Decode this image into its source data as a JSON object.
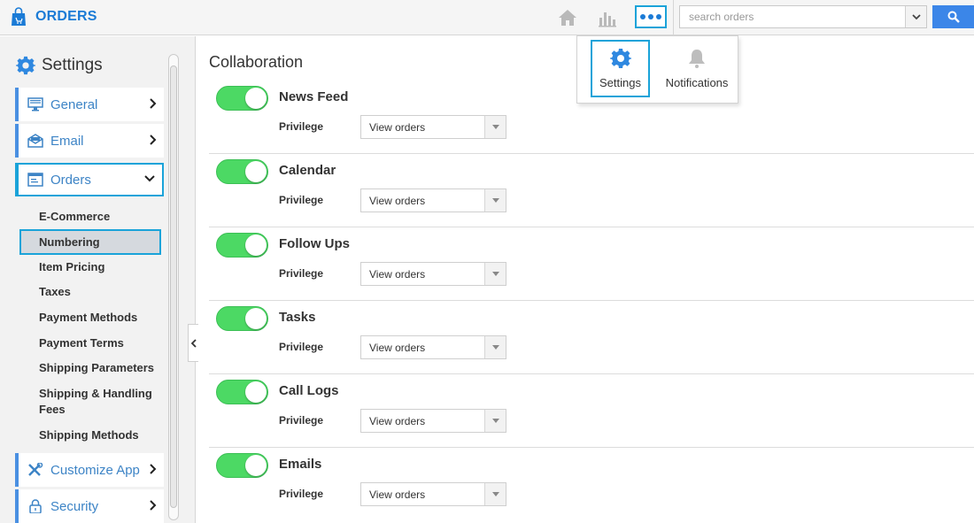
{
  "app": {
    "title": "ORDERS"
  },
  "topbar": {
    "search_placeholder": "search orders"
  },
  "popup": {
    "settings_label": "Settings",
    "notifications_label": "Notifications"
  },
  "sidebar": {
    "title": "Settings",
    "nav": [
      {
        "label": "General"
      },
      {
        "label": "Email"
      },
      {
        "label": "Orders"
      },
      {
        "label": "Customize App"
      },
      {
        "label": "Security"
      }
    ],
    "subitems": [
      {
        "label": "E-Commerce"
      },
      {
        "label": "Numbering"
      },
      {
        "label": "Item Pricing"
      },
      {
        "label": "Taxes"
      },
      {
        "label": "Payment Methods"
      },
      {
        "label": "Payment Terms"
      },
      {
        "label": "Shipping Parameters"
      },
      {
        "label": "Shipping & Handling Fees"
      },
      {
        "label": "Shipping Methods"
      }
    ]
  },
  "main": {
    "title": "Collaboration",
    "rows": [
      {
        "title": "News Feed",
        "privilege_label": "Privilege",
        "privilege_value": "View orders"
      },
      {
        "title": "Calendar",
        "privilege_label": "Privilege",
        "privilege_value": "View orders"
      },
      {
        "title": "Follow Ups",
        "privilege_label": "Privilege",
        "privilege_value": "View orders"
      },
      {
        "title": "Tasks",
        "privilege_label": "Privilege",
        "privilege_value": "View orders"
      },
      {
        "title": "Call Logs",
        "privilege_label": "Privilege",
        "privilege_value": "View orders"
      },
      {
        "title": "Emails",
        "privilege_label": "Privilege",
        "privilege_value": "View orders"
      }
    ]
  },
  "colors": {
    "brand": "#1b7bd6",
    "highlight": "#1aa3d9",
    "toggle_on": "#4cd964",
    "search_button": "#3b86e8"
  }
}
